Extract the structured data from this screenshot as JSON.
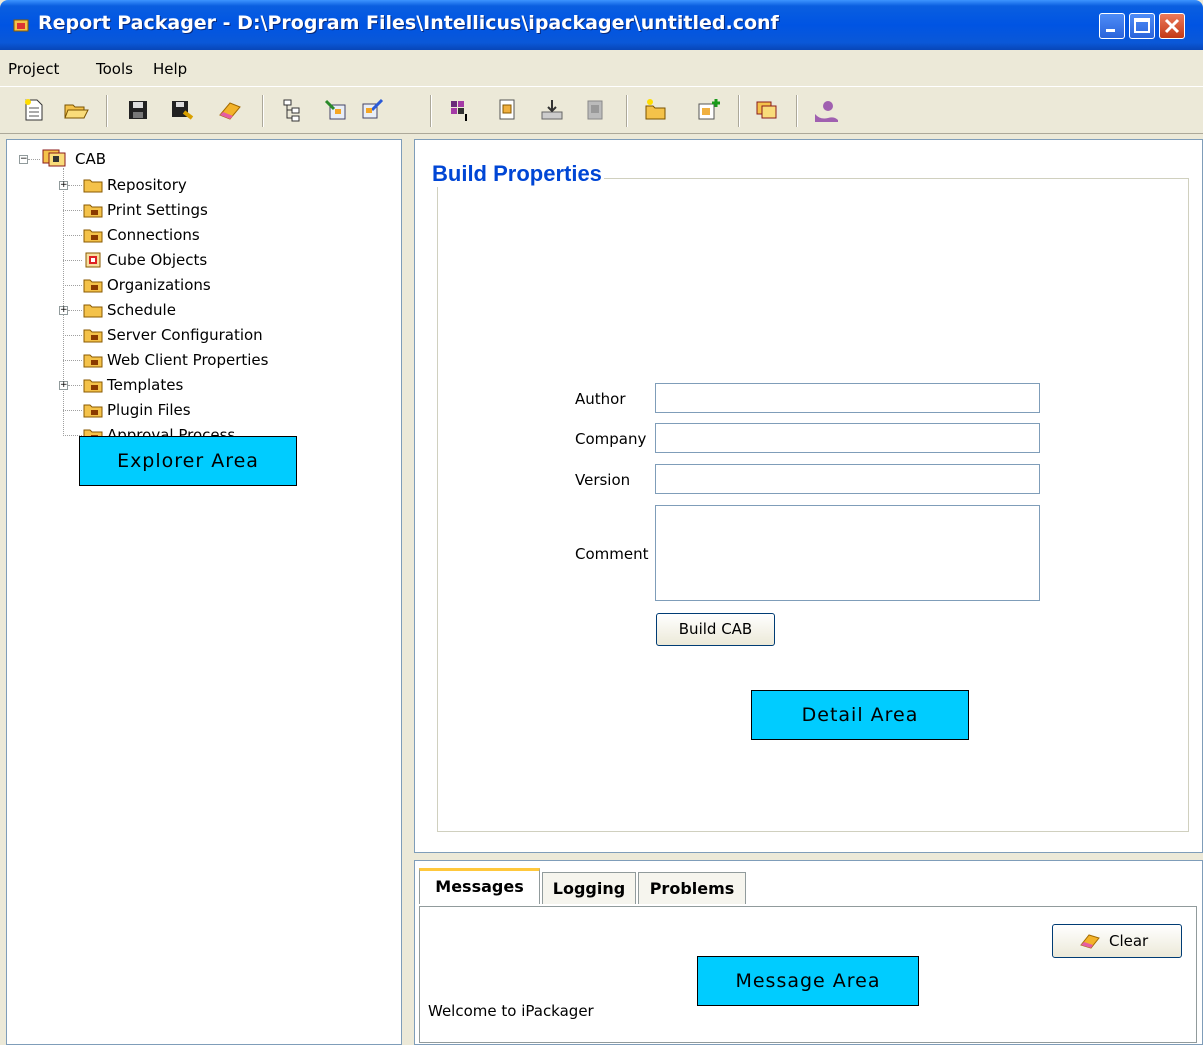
{
  "window": {
    "title": "Report Packager - D:\\Program Files\\Intellicus\\ipackager\\untitled.conf"
  },
  "menu": [
    "Project",
    "Tools",
    "Help"
  ],
  "toolbar": {
    "buttons": [
      "new-icon",
      "open-icon",
      "save-icon",
      "save-as-icon",
      "clear-icon",
      "tree-icon",
      "import-icon",
      "export-icon",
      "grid-icon",
      "package-icon",
      "deploy-icon",
      "remove-icon",
      "folder-new-icon",
      "add-item-icon",
      "copy-icon",
      "logo-icon"
    ]
  },
  "explorer": {
    "root": "CAB",
    "items": [
      {
        "label": "Repository",
        "expandable": true
      },
      {
        "label": "Print Settings",
        "expandable": false
      },
      {
        "label": "Connections",
        "expandable": false
      },
      {
        "label": "Cube Objects",
        "expandable": false
      },
      {
        "label": "Organizations",
        "expandable": false
      },
      {
        "label": "Schedule",
        "expandable": true
      },
      {
        "label": "Server Configuration",
        "expandable": false
      },
      {
        "label": "Web Client Properties",
        "expandable": false
      },
      {
        "label": "Templates",
        "expandable": true
      },
      {
        "label": "Plugin Files",
        "expandable": false
      },
      {
        "label": "Approval Process",
        "expandable": false
      }
    ],
    "callout": "Explorer Area"
  },
  "detail": {
    "group_title": "Build Properties",
    "fields": {
      "author_label": "Author",
      "author_value": "",
      "company_label": "Company",
      "company_value": "",
      "version_label": "Version",
      "version_value": "",
      "comment_label": "Comment",
      "comment_value": ""
    },
    "build_button": "Build CAB",
    "callout": "Detail Area"
  },
  "messages": {
    "tabs": [
      "Messages",
      "Logging",
      "Problems"
    ],
    "active_tab": "Messages",
    "clear_button": "Clear",
    "text": "Welcome to iPackager",
    "callout": "Message Area"
  },
  "colors": {
    "titlebar": "#0054e3",
    "callout": "#00ccff",
    "group_title": "#0046d5"
  }
}
